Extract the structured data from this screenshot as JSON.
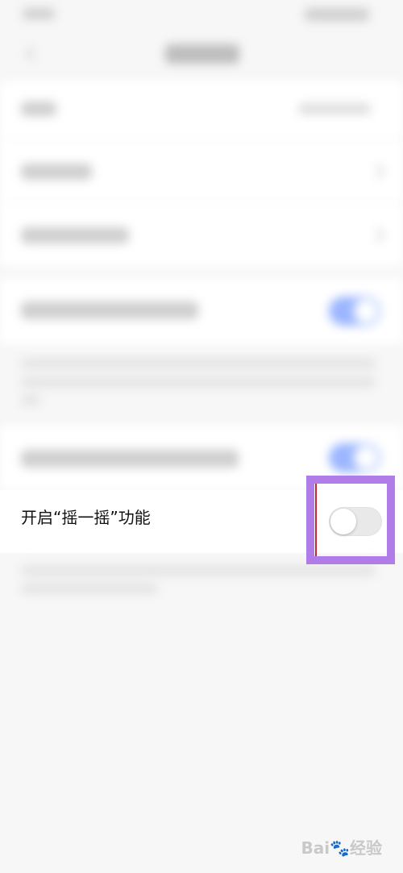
{
  "setting": {
    "shake_label": "开启“摇一摇”功能",
    "shake_enabled": false
  },
  "watermark": {
    "brand_text": "Bai",
    "tail_text": "经验"
  }
}
